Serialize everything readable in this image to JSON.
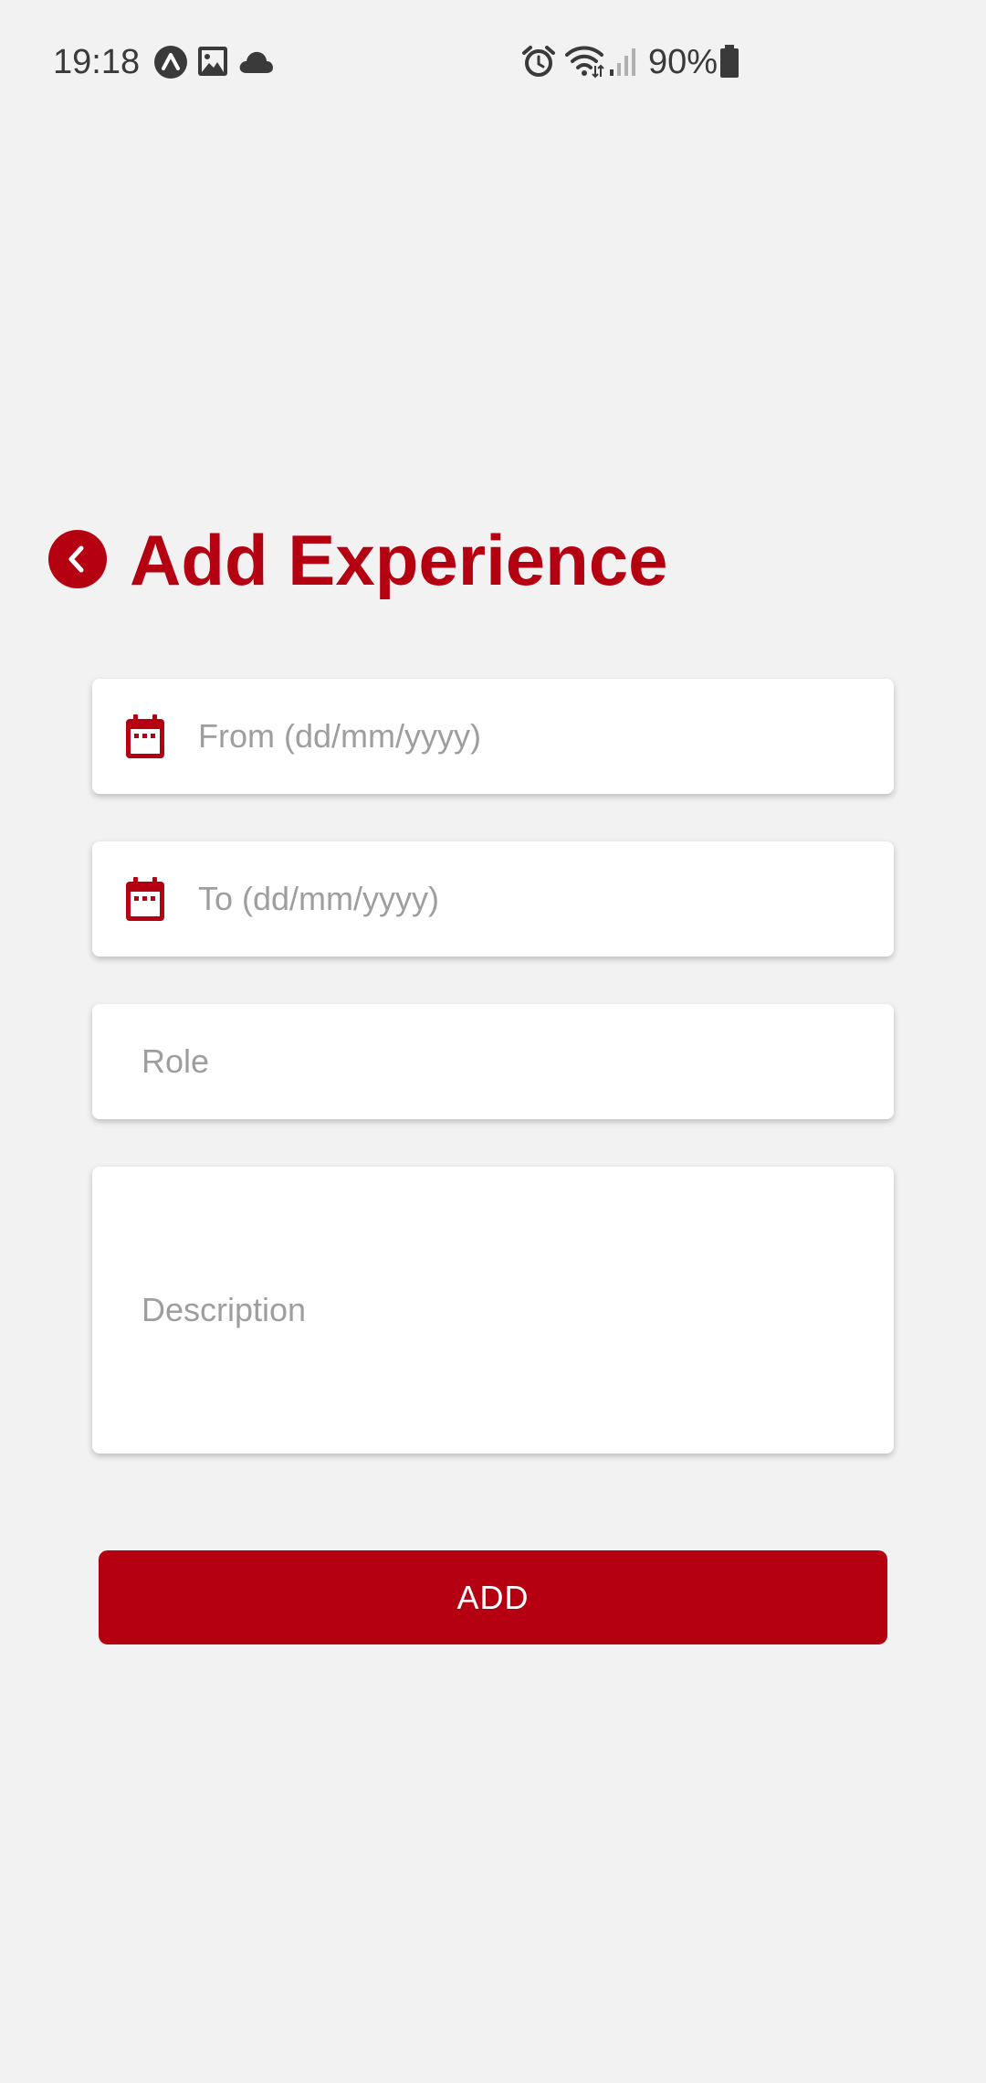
{
  "status_bar": {
    "time": "19:18",
    "battery": "90%",
    "left_icons": [
      "app-notification-icon",
      "gallery-icon",
      "cloud-icon"
    ],
    "right_icons": [
      "alarm-icon",
      "wifi-icon",
      "signal-icon",
      "battery-icon"
    ]
  },
  "header": {
    "back_icon": "chevron-left-icon",
    "title": "Add Experience"
  },
  "form": {
    "from_placeholder": "From (dd/mm/yyyy)",
    "to_placeholder": "To (dd/mm/yyyy)",
    "role_placeholder": "Role",
    "description_placeholder": "Description",
    "date_icon": "calendar-icon"
  },
  "actions": {
    "add_label": "ADD"
  },
  "colors": {
    "accent": "#b50012",
    "background": "#f2f2f2",
    "field_background": "#ffffff",
    "placeholder": "#9e9e9e"
  }
}
